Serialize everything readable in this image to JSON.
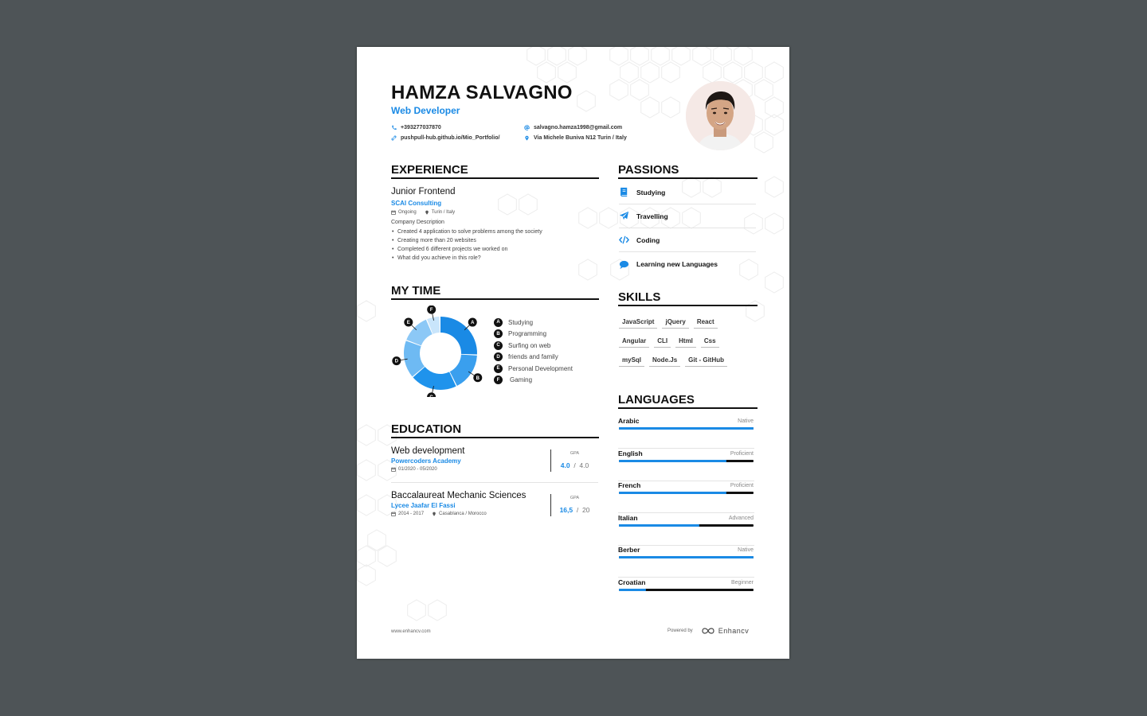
{
  "header": {
    "name": "HAMZA SALVAGNO",
    "role": "Web Developer",
    "phone": "+393277037870",
    "email": "salvagno.hamza1998@gmail.com",
    "website": "pushpull-hub.github.io/Mio_Portfolio/",
    "address": "Via Michele Buniva N12  Turin / Italy"
  },
  "experience": {
    "title": "EXPERIENCE",
    "job_title": "Junior Frontend",
    "company": "SCAI Consulting",
    "date": "Ongoing",
    "location": "Turin / Italy",
    "description": "Company Description",
    "bullets": [
      "Created 4 application to solve problems among the society",
      "Creating more than 20 websites",
      "Completed 6 different projects we worked on",
      "What did you achieve in this role?"
    ]
  },
  "my_time": {
    "title": "MY TIME",
    "legend": [
      {
        "letter": "A",
        "label": "Studying"
      },
      {
        "letter": "B",
        "label": "Programming"
      },
      {
        "letter": "C",
        "label": "Surfing on web"
      },
      {
        "letter": "D",
        "label": "friends and family"
      },
      {
        "letter": "E",
        "label": "Personal Development"
      },
      {
        "letter": "F",
        "label": "Gaming"
      }
    ]
  },
  "chart_data": {
    "type": "pie",
    "categories": [
      "Studying",
      "Programming",
      "Surfing on web",
      "friends and family",
      "Personal Development",
      "Gaming"
    ],
    "labels": [
      "A",
      "B",
      "C",
      "D",
      "E",
      "F"
    ],
    "values": [
      26,
      17,
      21,
      17,
      13,
      6
    ],
    "colors": [
      "#1a8ae5",
      "#3a9fee",
      "#1f93ec",
      "#6ebaf3",
      "#8cc8f6",
      "#c9e5fb"
    ]
  },
  "education": {
    "title": "EDUCATION",
    "entries": [
      {
        "degree": "Web development",
        "school": "Powercoders Academy",
        "date": "01/2020 - 05/2020",
        "location": "",
        "gpa_label": "GPA",
        "gpa": "4.0",
        "gpa_max": "4.0"
      },
      {
        "degree": "Baccalaureat Mechanic Sciences",
        "school": "Lycee Jaafar El Fassi",
        "date": "2014 - 2017",
        "location": "Casablanca / Morocco",
        "gpa_label": "GPA",
        "gpa": "16,5",
        "gpa_max": "20"
      }
    ]
  },
  "passions": {
    "title": "PASSIONS",
    "items": [
      {
        "label": "Studying",
        "icon": "book-icon"
      },
      {
        "label": "Travelling",
        "icon": "plane-icon"
      },
      {
        "label": "Coding",
        "icon": "code-icon"
      },
      {
        "label": "Learning new Languages",
        "icon": "chat-icon"
      }
    ]
  },
  "skills": {
    "title": "SKILLS",
    "items": [
      "JavaScript",
      "jQuery",
      "React",
      "Angular",
      "CLI",
      "Html",
      "Css",
      "mySql",
      "Node.Js",
      "Git - GitHub"
    ]
  },
  "languages": {
    "title": "LANGUAGES",
    "items": [
      {
        "name": "Arabic",
        "level": "Native",
        "fraction": 1.0
      },
      {
        "name": "English",
        "level": "Proficient",
        "fraction": 0.8
      },
      {
        "name": "French",
        "level": "Proficient",
        "fraction": 0.8
      },
      {
        "name": "Italian",
        "level": "Advanced",
        "fraction": 0.6
      },
      {
        "name": "Berber",
        "level": "Native",
        "fraction": 1.0
      },
      {
        "name": "Croatian",
        "level": "Beginner",
        "fraction": 0.2
      }
    ]
  },
  "footer": {
    "website": "www.enhancv.com",
    "powered_by": "Powered by",
    "brand": "Enhancv"
  },
  "colors": {
    "accent": "#1a8ae5",
    "background": "#4e5457"
  }
}
